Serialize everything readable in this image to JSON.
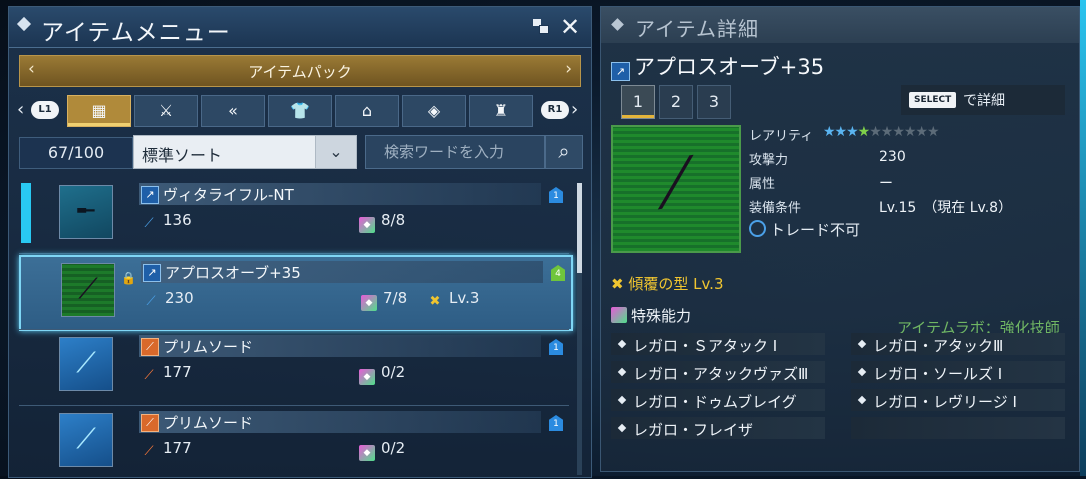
{
  "left_panel": {
    "title": "アイテムメニュー",
    "pack_label": "アイテムパック",
    "lb_label": "L1",
    "rb_label": "R1",
    "count": "67/100",
    "sort_value": "標準ソート",
    "search_placeholder": "検索ワードを入力",
    "items": [
      {
        "name": "ヴィタライフル-NT",
        "attack": "136",
        "sop": "8/8",
        "potential": ""
      },
      {
        "name": "アプロスオーブ+35",
        "attack": "230",
        "sop": "7/8",
        "potential": "Lv.3"
      },
      {
        "name": "プリムソード",
        "attack": "177",
        "sop": "0/2",
        "potential": ""
      },
      {
        "name": "プリムソード",
        "attack": "177",
        "sop": "0/2",
        "potential": ""
      }
    ]
  },
  "right_panel": {
    "title": "アイテム詳細",
    "item_name": "アプロスオーブ+35",
    "tabs": [
      "1",
      "2",
      "3"
    ],
    "select_key": "SELECT",
    "select_label": "で詳細",
    "rarity_label": "レアリティ",
    "rarity": 4,
    "attack_label": "攻撃力",
    "attack_value": "230",
    "element_label": "属性",
    "element_value": "ー",
    "equip_label": "装備条件",
    "equip_value": "Lv.15　（現在 Lv.8）",
    "trade": "トレード不可",
    "potential": "傾覆の型 Lv.3",
    "abilities_title": "特殊能力",
    "lab_note": "アイテムラボ：強化技師",
    "abilities": [
      "レガロ・Ｓアタック Ⅰ",
      "レガロ・アタックⅢ",
      "レガロ・アタックヴァズⅢ",
      "レガロ・ソールズ Ⅰ",
      "レガロ・ドゥムブレイグ",
      "レガロ・レヴリージ Ⅰ",
      "レガロ・フレイザ"
    ]
  },
  "colors": {
    "accent": "#29c9f2",
    "gold": "#b08a3a",
    "potential": "#f0c530"
  }
}
